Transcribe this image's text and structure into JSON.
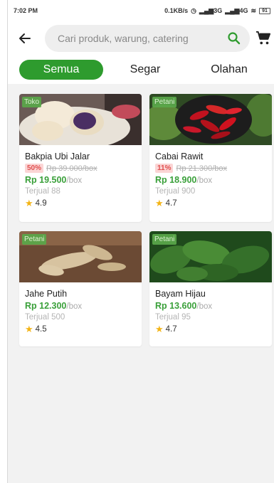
{
  "status_bar": {
    "time": "7:02 PM",
    "net_speed": "0.1KB/s",
    "signal_1": "3G",
    "signal_2": "4G",
    "battery": "91"
  },
  "search": {
    "placeholder": "Cari produk, warung, catering"
  },
  "tabs": [
    {
      "label": "Semua",
      "active": true
    },
    {
      "label": "Segar",
      "active": false
    },
    {
      "label": "Olahan",
      "active": false
    }
  ],
  "products": [
    {
      "name": "Bakpia Ubi Jalar",
      "badge": "Toko",
      "discount": "50%",
      "original_price": "Rp 39.000/box",
      "price": "Rp 19.500",
      "unit": "/box",
      "sold": "Terjual 88",
      "rating": "4.9"
    },
    {
      "name": "Cabai Rawit",
      "badge": "Petani",
      "discount": "11%",
      "original_price": "Rp 21.300/box",
      "price": "Rp 18.900",
      "unit": "/box",
      "sold": "Terjual 900",
      "rating": "4.7"
    },
    {
      "name": "Jahe Putih",
      "badge": "Petani",
      "price": "Rp 12.300",
      "unit": "/box",
      "sold": "Terjual 500",
      "rating": "4.5"
    },
    {
      "name": "Bayam Hijau",
      "badge": "Petani",
      "price": "Rp 13.600",
      "unit": "/box",
      "sold": "Terjual 95",
      "rating": "4.7"
    }
  ],
  "colors": {
    "accent": "#2e9b2e",
    "price": "#3aa03a",
    "discount_bg": "#fbd5d5",
    "discount_text": "#e05050",
    "star": "#f3b416"
  },
  "icons": {
    "back": "arrow-left-icon",
    "search": "search-icon",
    "cart": "cart-icon",
    "rating": "star-icon"
  }
}
